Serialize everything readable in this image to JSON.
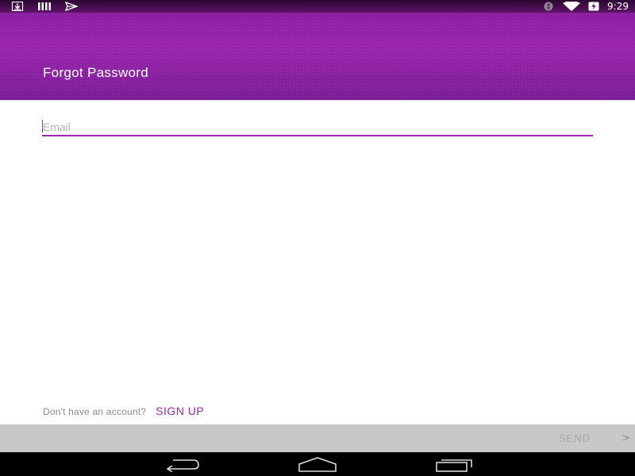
{
  "status_bar": {
    "left_icons": [
      "download-icon",
      "bars-icon",
      "send-icon"
    ],
    "right_icons": [
      "bluetooth-icon",
      "wifi-icon",
      "battery-charging-icon"
    ],
    "time": "9:29"
  },
  "header": {
    "title": "Forgot Password",
    "color": "#9b27af"
  },
  "form": {
    "email": {
      "placeholder": "Email",
      "value": ""
    }
  },
  "signup": {
    "prompt": "Don't have an account?",
    "link_label": "SIGN UP"
  },
  "send_bar": {
    "label": "SEND",
    "chevron": ">"
  },
  "nav_bar": {
    "buttons": [
      "back-icon",
      "home-icon",
      "recents-icon"
    ]
  },
  "colors": {
    "accent": "#9b27af",
    "send_bar_bg": "#c8c8c8",
    "nav_bar_bg": "#000000"
  }
}
